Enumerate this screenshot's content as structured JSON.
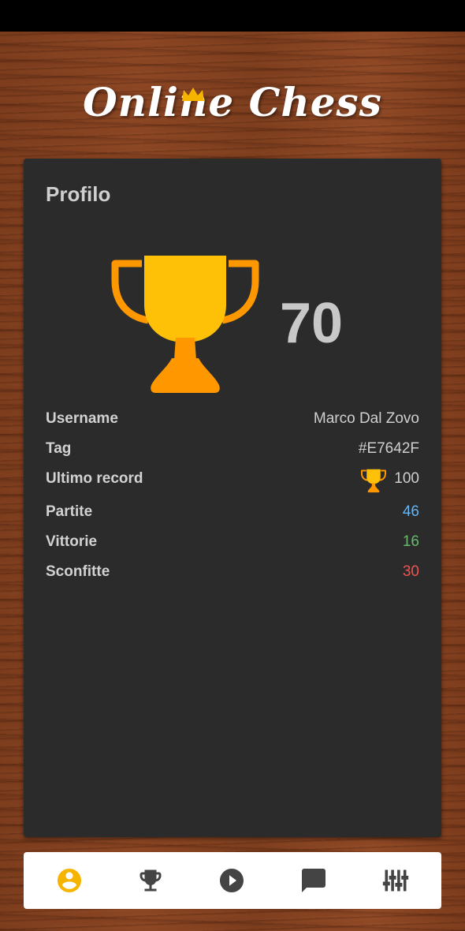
{
  "app": {
    "title": "Online Chess"
  },
  "profile": {
    "heading": "Profilo",
    "trophies": "70",
    "rows": [
      {
        "label": "Username",
        "value": "Marco Dal Zovo",
        "color": "#cfcfcf"
      },
      {
        "label": "Tag",
        "value": "#E7642F",
        "color": "#cfcfcf"
      },
      {
        "label": "Ultimo record",
        "value": "100",
        "color": "#cfcfcf",
        "icon": "trophy-icon"
      },
      {
        "label": "Partite",
        "value": "46",
        "color": "#64b5f6"
      },
      {
        "label": "Vittorie",
        "value": "16",
        "color": "#66bb6a"
      },
      {
        "label": "Sconfitte",
        "value": "30",
        "color": "#ef5350"
      }
    ]
  },
  "nav": {
    "items": [
      {
        "name": "profile",
        "icon": "account-circle-icon",
        "active": true
      },
      {
        "name": "ranking",
        "icon": "trophy-icon",
        "active": false
      },
      {
        "name": "play",
        "icon": "play-circle-icon",
        "active": false
      },
      {
        "name": "chat",
        "icon": "chat-icon",
        "active": false
      },
      {
        "name": "settings",
        "icon": "sliders-icon",
        "active": false
      }
    ],
    "active_color": "#f5b400",
    "inactive_color": "#444444"
  },
  "colors": {
    "trophy_gold": "#ffc107",
    "trophy_orange": "#ff9800",
    "card_bg": "#2b2b2b"
  }
}
